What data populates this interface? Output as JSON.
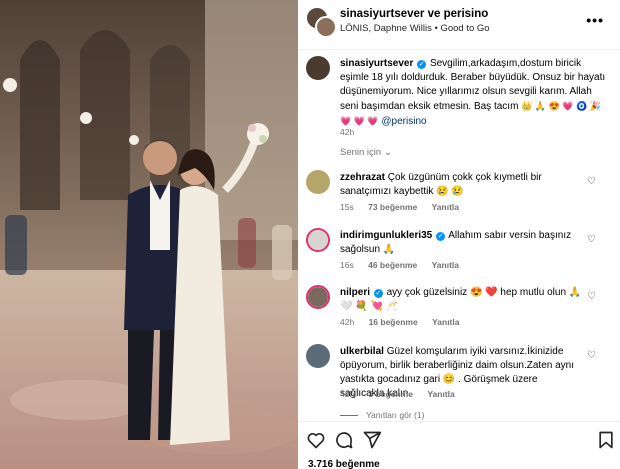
{
  "header": {
    "title": "sinasiyurtsever ve perisino",
    "subtitle": "LÖNIS, Daphne Willis • Good to Go"
  },
  "caption": {
    "username": "sinasiyurtsever",
    "text_before": "Sevgilim,arkadaşım,dostum biricik eşimle 18 yılı doldurduk. Beraber büyüdük. Onsuz bir hayatı düşünemiyorum. Nice yıllarımız olsun sevgili karım. Allah seni başımdan eksik etmesin. Baş tacım",
    "emojis": "👑 🙏 😍 💗 🧿 🎉 💗 💗 💗",
    "mention": "@perisino",
    "time": "42h"
  },
  "filter_label": "Senin için",
  "comments": [
    {
      "username": "zzehrazat",
      "text": "Çok üzgünüm çokk çok kıymetli bir sanatçımızı kaybettik 😢 😢",
      "time": "15s",
      "likes": "73 beğenme",
      "reply": "Yanıtla"
    },
    {
      "username": "indirimgunlukleri35",
      "text": "Allahım sabır versin başınız sağolsun 🙏",
      "time": "16s",
      "likes": "46 beğenme",
      "reply": "Yanıtla"
    },
    {
      "username": "nilperi",
      "text": "ayy çok güzelsiniz 😍 ❤️ hep mutlu olun 🙏 🤍 💐 💘 🥂",
      "time": "42h",
      "likes": "16 beğenme",
      "reply": "Yanıtla"
    },
    {
      "username": "ulkerbilal",
      "text": "Güzel komşularım iyiki varsınız.İkinizide öpüyorum, birlik beraberliğiniz daim olsun.Zaten aynı yastıkta gocadınız gari 😊 . Görüşmek üzere sağlıcakla kalın.",
      "time": "42h",
      "likes": "3 beğenme",
      "reply": "Yanıtla"
    }
  ],
  "view_replies": "Yanıtları gör (1)",
  "likes_total": "3.716 beğenme",
  "icons": [
    "heart-icon",
    "comment-icon",
    "share-icon",
    "bookmark-icon",
    "more-icon",
    "verified-icon"
  ],
  "colors": {
    "verified": "#0095f6",
    "link": "#00376b",
    "muted": "#737373",
    "story_ring": "#e1306c"
  }
}
